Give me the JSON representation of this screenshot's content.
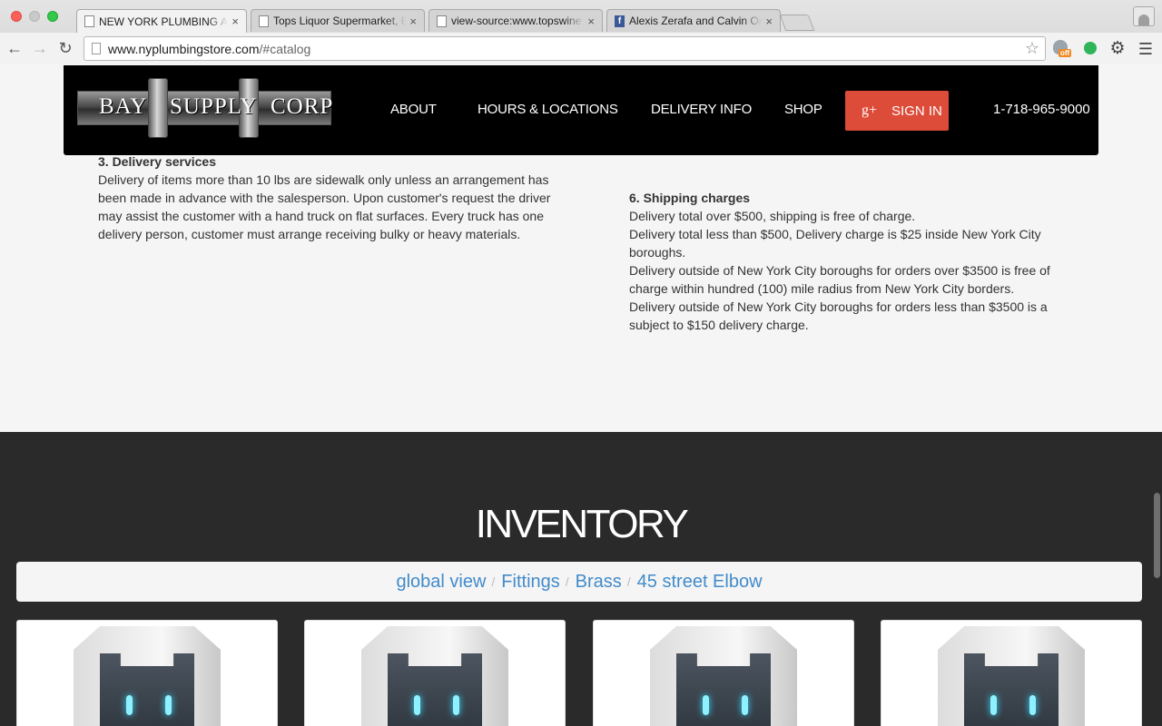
{
  "browser": {
    "tabs": [
      {
        "title": "NEW YORK PLUMBING AND",
        "active": true,
        "icon": "page-icon"
      },
      {
        "title": "Tops Liquor Supermarket, B",
        "active": false,
        "icon": "page-icon"
      },
      {
        "title": "view-source:www.topswine",
        "active": false,
        "icon": "page-icon"
      },
      {
        "title": "Alexis Zerafa and Calvin Or",
        "active": false,
        "icon": "facebook-icon"
      }
    ],
    "close_glyph": "×",
    "url_host": "www.nyplumbingstore.com",
    "url_path": "/#catalog",
    "extension_badge": "off",
    "fb_glyph": "f"
  },
  "header": {
    "logo_words": [
      "BAY",
      "SUPPLY",
      "CORP"
    ],
    "nav": [
      "ABOUT",
      "HOURS & LOCATIONS",
      "DELIVERY INFO",
      "SHOP"
    ],
    "signin_icon": "g+",
    "signin_label": "SIGN IN",
    "phone": "1-718-965-9000"
  },
  "policy": {
    "delivery_services": {
      "heading": "3. Delivery services",
      "body": "Delivery of items more than 10 lbs are sidewalk only unless an arrangement has been made in advance with the salesperson. Upon customer's request the driver may assist the customer with a hand truck on flat surfaces. Every truck has one delivery person, customer must arrange receiving bulky or heavy materials."
    },
    "shipping_charges": {
      "heading": "6. Shipping charges",
      "lines": [
        "Delivery total over $500, shipping is free of charge.",
        "Delivery total less than $500, Delivery charge is $25 inside New York City boroughs.",
        "Delivery outside of New York City boroughs for orders over $3500 is free of charge within hundred (100) mile radius from New York City borders.",
        "Delivery outside of New York City boroughs for orders less than $3500 is a subject to $150 delivery charge."
      ]
    }
  },
  "inventory": {
    "title": "INVENTORY",
    "breadcrumb": [
      "global view",
      "Fittings",
      "Brass",
      "45 street Elbow"
    ],
    "separator": "/",
    "product_count": 4
  },
  "colors": {
    "signin_red": "#dd4b39",
    "link_blue": "#428bca",
    "inventory_bg": "#2a2a2a",
    "header_bg": "#000000"
  }
}
